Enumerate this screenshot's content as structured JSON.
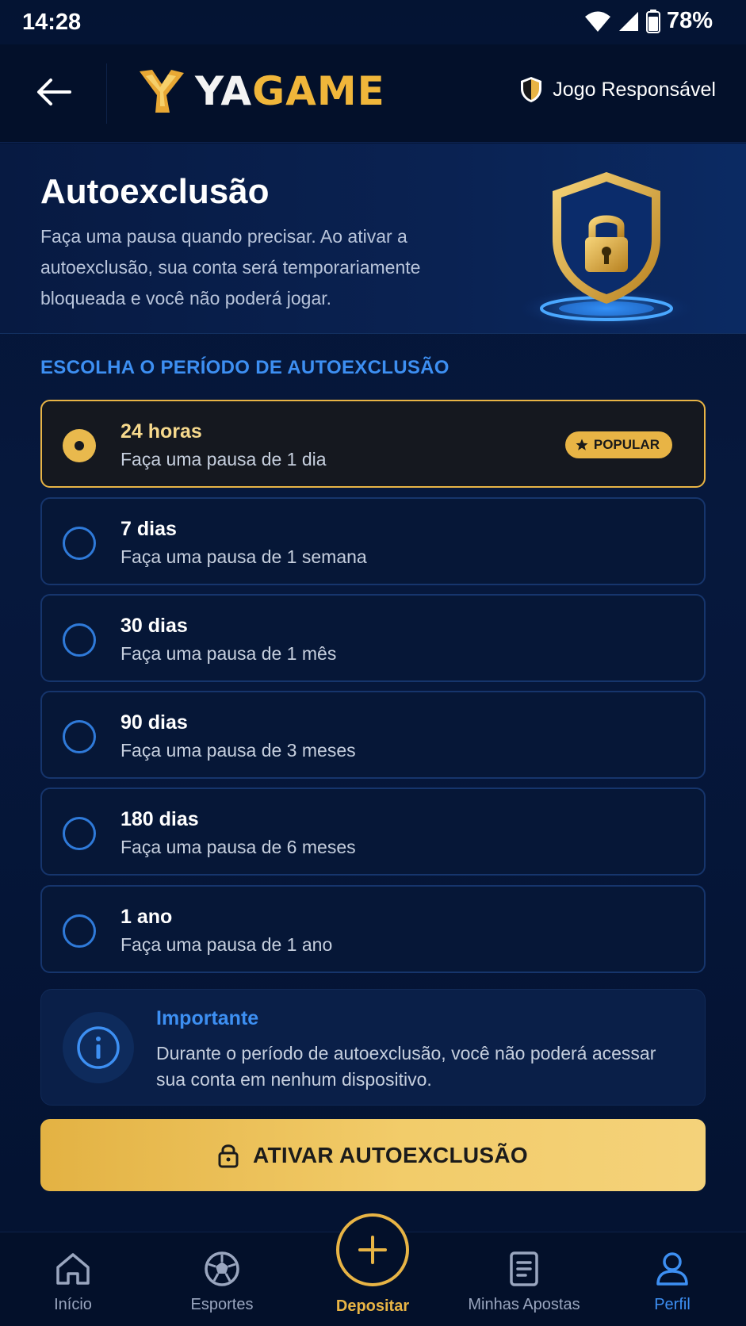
{
  "status_bar": {
    "time": "14:28",
    "battery": "78%"
  },
  "header": {
    "brand_part1": "YA",
    "brand_part2": "GAME",
    "responsible_label": "Jogo Responsável"
  },
  "hero": {
    "title": "Autoexclusão",
    "description": "Faça uma pausa quando precisar. Ao ativar a autoexclusão, sua conta será temporariamente bloqueada e você não poderá jogar."
  },
  "section_label": "ESCOLHA O PERÍODO DE AUTOEXCLUSÃO",
  "options": [
    {
      "title": "24 horas",
      "subtitle": "Faça uma pausa de 1 dia",
      "selected": true,
      "badge": "POPULAR"
    },
    {
      "title": "7 dias",
      "subtitle": "Faça uma pausa de 1 semana",
      "selected": false
    },
    {
      "title": "30 dias",
      "subtitle": "Faça uma pausa de 1 mês",
      "selected": false
    },
    {
      "title": "90 dias",
      "subtitle": "Faça uma pausa de 3 meses",
      "selected": false
    },
    {
      "title": "180 dias",
      "subtitle": "Faça uma pausa de 6 meses",
      "selected": false
    },
    {
      "title": "1 ano",
      "subtitle": "Faça uma pausa de 1 ano",
      "selected": false
    }
  ],
  "info": {
    "title": "Importante",
    "text": "Durante o período de autoexclusão, você não poderá acessar sua conta em nenhum dispositivo."
  },
  "cta": {
    "label": "ATIVAR AUTOEXCLUSÃO"
  },
  "bottom_nav": {
    "items": [
      {
        "label": "Início",
        "icon": "home-icon"
      },
      {
        "label": "Esportes",
        "icon": "soccer-ball-icon"
      },
      {
        "label": "Depositar",
        "icon": "plus-icon"
      },
      {
        "label": "Minhas Apostas",
        "icon": "document-icon"
      },
      {
        "label": "Perfil",
        "icon": "user-icon",
        "active": true
      }
    ]
  },
  "colors": {
    "accent_gold": "#e8b445",
    "accent_blue": "#3d8ff2",
    "background": "#041433"
  }
}
